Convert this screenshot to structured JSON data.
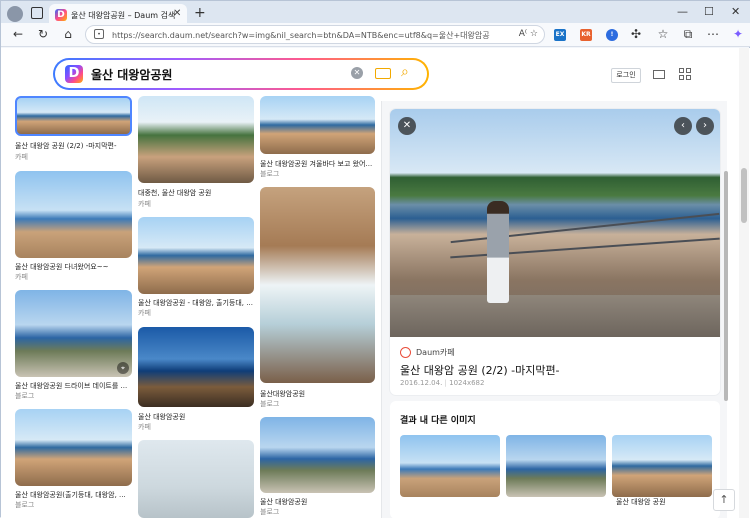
{
  "browser": {
    "tab_title": "울산 대왕암공원 – Daum 검색",
    "tab_close": "✕",
    "new_tab": "+",
    "minimize": "—",
    "maximize": "☐",
    "close": "✕",
    "url": "https://search.daum.net/search?w=img&nil_search=btn&DA=NTB&enc=utf8&q=울산+대왕암공원&vimg...",
    "ext_labels": [
      "EX",
      "KR"
    ]
  },
  "search": {
    "logo": "D",
    "query": "울산 대왕암공원",
    "clear": "✕",
    "search_icon": "⌕"
  },
  "header": {
    "login": "로그인"
  },
  "results": [
    {
      "caption": "울산 대왕암 공원 (2/2) -마지막편-",
      "source": "카페"
    },
    {
      "caption": "울산 대왕암공원 다녀왔어요~~",
      "source": "카페"
    },
    {
      "caption": "울산 대왕암공원 드라이브 데이트를 ...",
      "source": "블로그"
    },
    {
      "caption": "울산 대왕암공원(출기등대, 대왕암, ...",
      "source": "블로그"
    },
    {
      "caption": "대중천, 울산 대왕암 공원",
      "source": "카페"
    },
    {
      "caption": "울산 대왕암공원 - 대왕암, 출기등대, ...",
      "source": "카페"
    },
    {
      "caption": "울산 대왕암공원",
      "source": "카페"
    },
    {
      "caption": "울산 대왕암공원 겨울바다 보고 왔어...",
      "source": "블로그"
    },
    {
      "caption": "울산대왕암공원",
      "source": "블로그"
    },
    {
      "caption": "울산 대왕암공원",
      "source": "블로그"
    }
  ],
  "detail": {
    "source_name": "Daum카페",
    "title": "울산 대왕암 공원 (2/2) -마지막편-",
    "date": "2016.12.04.",
    "size": "1024x682",
    "close": "✕",
    "prev": "‹",
    "next": "›",
    "related_title": "결과 내 다른 이미지",
    "related_caption": "울산 대왕암 공원"
  },
  "top_button": "↑"
}
